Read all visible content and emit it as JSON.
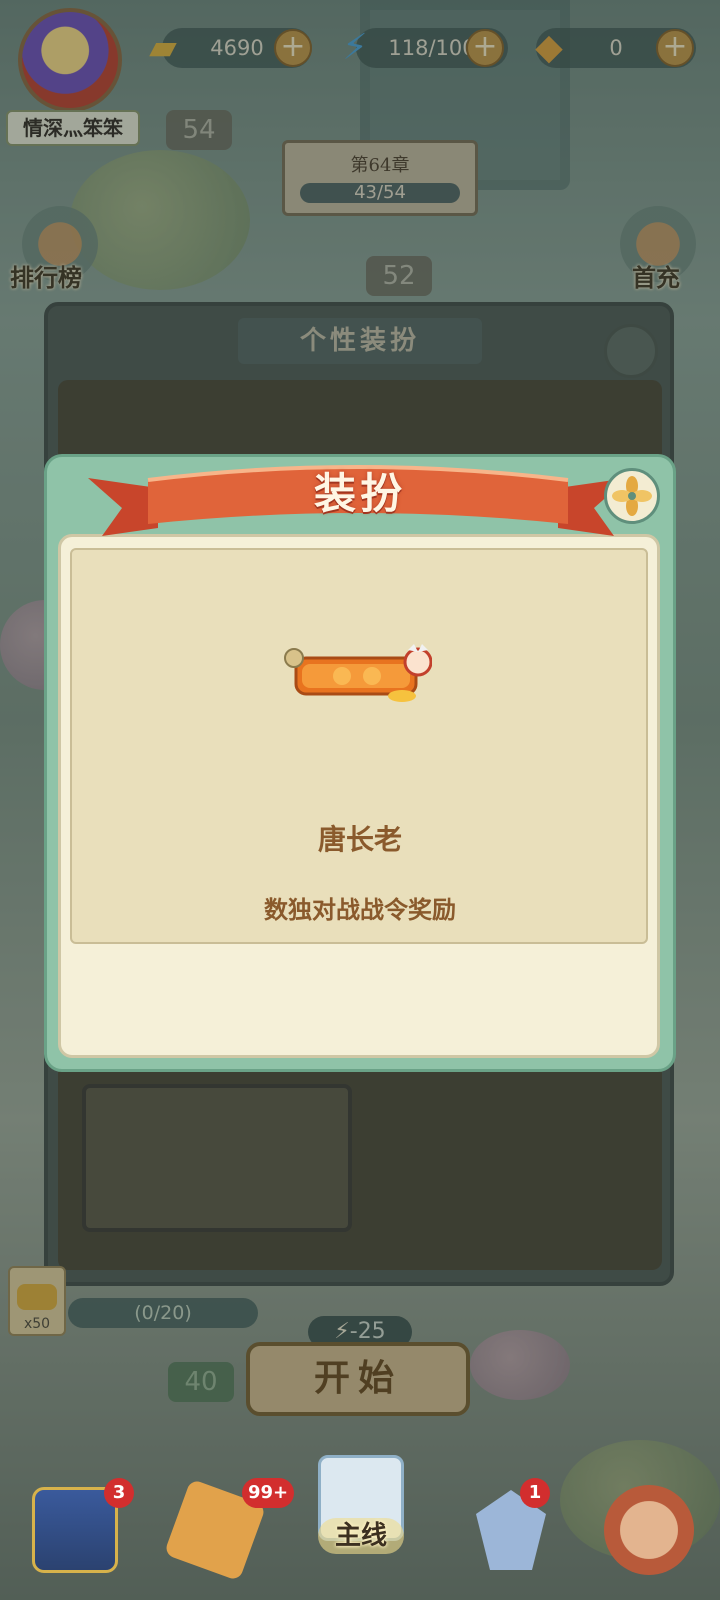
{
  "topbar": {
    "nickname": "情深灬笨笨",
    "gold": "4690",
    "energy": "118/100",
    "gems": "0",
    "plus": "+"
  },
  "map": {
    "chapter_title": "第64章",
    "chapter_progress": "43/54",
    "levels": [
      "54",
      "52",
      "40"
    ]
  },
  "side_menu": {
    "left": [
      "排行榜"
    ],
    "right": [
      "首充"
    ]
  },
  "background_panel": {
    "title": "个性装扮"
  },
  "modal": {
    "title": "装扮",
    "item_name": "唐长老",
    "item_source": "数独对战战令奖励"
  },
  "bottom": {
    "reward_count": "x50",
    "reward_progress": "(0/20)",
    "energy_cost": "-25",
    "start_label": "开始",
    "nav": [
      {
        "icon": "shop-icon",
        "badge": "3"
      },
      {
        "icon": "puzzle-icon",
        "badge": "99+"
      },
      {
        "icon": "scroll-map-icon",
        "label": "主线"
      },
      {
        "icon": "battle-icon",
        "badge": "1"
      },
      {
        "icon": "profile-icon"
      }
    ]
  }
}
